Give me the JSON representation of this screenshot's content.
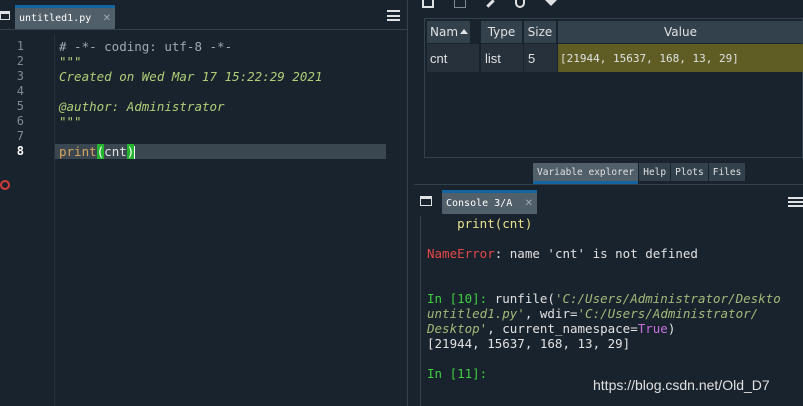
{
  "editor": {
    "tab_label": "untitled1.py",
    "tab_close": "✕",
    "line_numbers": [
      "1",
      "2",
      "3",
      "4",
      "5",
      "6",
      "7",
      "8"
    ],
    "lines": {
      "l1": "# -*- coding: utf-8 -*-",
      "l2": "\"\"\"",
      "l3": "Created on Wed Mar 17 15:22:29 2021",
      "l4": "",
      "l5": "@author: Administrator",
      "l6": "\"\"\"",
      "l7": "",
      "l8_func": "print",
      "l8_open": "(",
      "l8_arg": "cnt",
      "l8_close": ")"
    }
  },
  "variable_explorer": {
    "columns": {
      "name": "Nam",
      "type": "Type",
      "size": "Size",
      "value": "Value"
    },
    "rows": [
      {
        "name": "cnt",
        "type": "list",
        "size": "5",
        "value": "[21944, 15637, 168, 13, 29]"
      }
    ],
    "tabs": [
      "Variable explorer",
      "Help",
      "Plots",
      "Files"
    ],
    "active_tab": "Variable explorer"
  },
  "console": {
    "tab_label": "Console 3/A",
    "tab_close": "✕",
    "lines": {
      "prev_code": "    print(cnt)",
      "error_name": "NameError",
      "error_msg": ": name 'cnt' is not defined",
      "prompt10": "In [10]: ",
      "run_call": "runfile(",
      "path1": "'C:/Users/Administrator/Deskto",
      "path1_cont": "untitled1.py'",
      "wdir_label": ", wdir=",
      "path2": "'C:/Users/Administrator/",
      "path2_cont": "Desktop'",
      "ns_label": ", current_namespace=",
      "ns_value": "True",
      "close_paren": ")",
      "output": "[21944, 15637, 168, 13, 29]",
      "prompt11": "In [11]:"
    }
  },
  "watermark": "https://blog.csdn.net/Old_D7",
  "colors": {
    "background": "#19232d",
    "tab_active": "#505f69",
    "accent": "#1464a0",
    "prompt_green": "#3fce3f",
    "error_red": "#e64747",
    "highlight_value": "#5f5d24"
  }
}
